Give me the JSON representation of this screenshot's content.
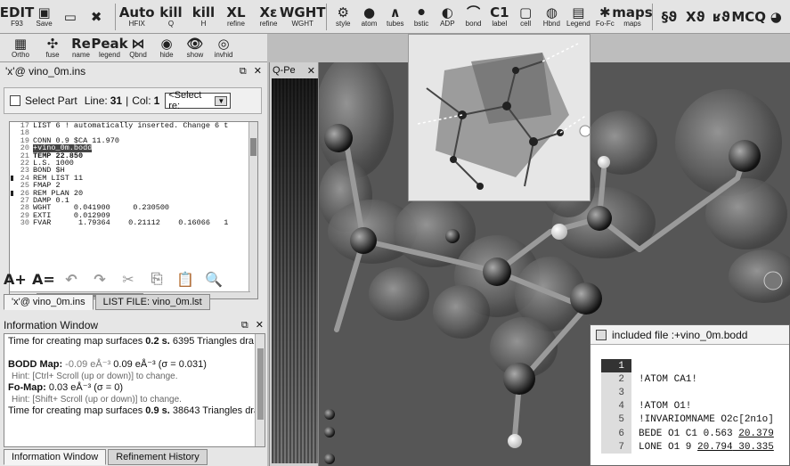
{
  "toolbar_main": {
    "buttons": [
      {
        "name": "open-ins-button",
        "icon": "EDIT",
        "label": "F93"
      },
      {
        "name": "save-button",
        "icon": "▣",
        "label": "Save"
      },
      {
        "name": "save-disk-button",
        "icon": "▭",
        "label": ""
      },
      {
        "name": "stop-button",
        "icon": "✖",
        "label": ""
      },
      {
        "name": "auto-hfix-button",
        "icon": "Auto",
        "label": "HFIX"
      },
      {
        "name": "kill-q-button",
        "icon": "kill",
        "label": "Q"
      },
      {
        "name": "kill-h-button",
        "icon": "kill",
        "label": "H"
      },
      {
        "name": "xl-refine-button",
        "icon": "XL",
        "label": "refine"
      },
      {
        "name": "xe-refine-button",
        "icon": "Xε",
        "label": "refine"
      },
      {
        "name": "wght-button",
        "icon": "WGHT",
        "label": "WGHT"
      }
    ],
    "view_buttons": [
      {
        "name": "style-button",
        "icon": "⚙",
        "label": "style"
      },
      {
        "name": "atom-button",
        "icon": "●",
        "label": "atom"
      },
      {
        "name": "tubes-button",
        "icon": "∧",
        "label": "tubes"
      },
      {
        "name": "bstic-button",
        "icon": "⚫",
        "label": "bstic"
      },
      {
        "name": "adp-button",
        "icon": "◐",
        "label": "ADP"
      },
      {
        "name": "bond-button",
        "icon": "⌒",
        "label": "bond"
      },
      {
        "name": "c1-label-button",
        "icon": "C1",
        "label": "label"
      },
      {
        "name": "cell-button",
        "icon": "▢",
        "label": "cell"
      },
      {
        "name": "hbnd-button",
        "icon": "◍",
        "label": "Hbnd"
      },
      {
        "name": "legend-button",
        "icon": "▤",
        "label": "Legend"
      },
      {
        "name": "fo-fc-button",
        "icon": "✱",
        "label": "Fo-Fc"
      },
      {
        "name": "maps-button",
        "icon": "maps",
        "label": "maps"
      }
    ],
    "right_buttons": [
      {
        "name": "sg-button",
        "icon": "§ϑ",
        "label": ""
      },
      {
        "name": "xg-button",
        "icon": "Xϑ",
        "label": ""
      },
      {
        "name": "rg-button",
        "icon": "ʁϑ",
        "label": ""
      },
      {
        "name": "mcq-button",
        "icon": "MCQ",
        "label": ""
      },
      {
        "name": "pie-button",
        "icon": "◕",
        "label": ""
      }
    ]
  },
  "toolbar_second": [
    {
      "name": "ortho-button",
      "icon": "▦",
      "label": "Ortho"
    },
    {
      "name": "fuse-button",
      "icon": "✣",
      "label": "fuse"
    },
    {
      "name": "rename-button",
      "icon": "Re",
      "label": "name"
    },
    {
      "name": "peak-legend-button",
      "icon": "Peak",
      "label": "legend"
    },
    {
      "name": "qbnd-button",
      "icon": "⋈",
      "label": "Qbnd"
    },
    {
      "name": "hide-button",
      "icon": "◉",
      "label": "hide"
    },
    {
      "name": "show-button",
      "icon": "👁",
      "label": "show"
    },
    {
      "name": "invhid-button",
      "icon": "◎",
      "label": "invhid"
    }
  ],
  "left_pane": {
    "title": "'x'@ vino_0m.ins",
    "select_part_label": "Select Part",
    "line_label": "Line:",
    "line_value": "31",
    "col_label": "Col:",
    "col_value": "1",
    "select_residue": "<Select re:",
    "editor_lines": [
      {
        "no": "17",
        "text": "LIST 6 ! automatically inserted. Change 6 t",
        "style": ""
      },
      {
        "no": "18",
        "text": "",
        "style": ""
      },
      {
        "no": "19",
        "text": "CONN 0.9 $CA 11.970",
        "style": ""
      },
      {
        "no": "20",
        "text": "+vino_0m.bodd",
        "style": "hl"
      },
      {
        "no": "21",
        "text": "TEMP 22.850",
        "style": "bold"
      },
      {
        "no": "22",
        "text": "L.S. 1000",
        "style": ""
      },
      {
        "no": "23",
        "text": "BOND $H",
        "style": ""
      },
      {
        "no": "24",
        "text": "REM LIST 11",
        "style": "mk"
      },
      {
        "no": "25",
        "text": "FMAP 2",
        "style": ""
      },
      {
        "no": "26",
        "text": "REM PLAN 20",
        "style": "mk"
      },
      {
        "no": "27",
        "text": "DAMP 0.1",
        "style": ""
      },
      {
        "no": "28",
        "text": "WGHT     0.041900     0.230500",
        "style": ""
      },
      {
        "no": "29",
        "text": "EXTI     0.012909",
        "style": ""
      },
      {
        "no": "30",
        "text": "FVAR      1.79364    0.21112    0.16066   1",
        "style": ""
      }
    ],
    "tabs": [
      "'x'@ vino_0m.ins",
      "LIST FILE: vino_0m.lst"
    ]
  },
  "info_window": {
    "title": "Information Window",
    "rows": [
      {
        "type": "plain",
        "text": "Time for creating map surfaces ",
        "bold": "0.2 s.",
        "rest": " 6395 Triangles dra"
      },
      {
        "type": "blank"
      },
      {
        "type": "map",
        "label": "BODD Map:",
        "g": "-0.09 eÅ⁻³",
        "rest": "  0.09 eÅ⁻³ (σ = 0.031)"
      },
      {
        "type": "hint",
        "text": "Hint:  [Ctrl+ Scroll (up or down)] to change."
      },
      {
        "type": "map2",
        "label": "Fo-Map:",
        "rest": " 0.03 eÅ⁻³ (σ =     0)"
      },
      {
        "type": "hint",
        "text": "Hint:  [Shift+ Scroll (up or down)] to change."
      },
      {
        "type": "plain",
        "text": "Time for creating map surfaces ",
        "bold": "0.9 s.",
        "rest": " 38643 Triangles dra"
      }
    ],
    "tabs": [
      "Information Window",
      "Refinement History"
    ]
  },
  "qpeaks": {
    "title": "Q-Pe"
  },
  "included_file": {
    "title": "included file :+vino_0m.bodd",
    "lines": [
      {
        "no": "1",
        "text": "",
        "cur": true
      },
      {
        "no": "2",
        "text": "!ATOM CA1!"
      },
      {
        "no": "3",
        "text": ""
      },
      {
        "no": "4",
        "text": "!ATOM O1!"
      },
      {
        "no": "5",
        "text": "!INVARIOMNAME O2c[2n1o]"
      },
      {
        "no": "6",
        "text": "BEDE O1 C1 0.563 ",
        "u": "20.379"
      },
      {
        "no": "7",
        "text": "LONE O1 9 ",
        "u": "20.794",
        "rest": " 30.335"
      }
    ]
  },
  "colors": {
    "background": "#bdbdbd",
    "panel": "#e6e6e6",
    "viewport": "#5a5a5a"
  }
}
